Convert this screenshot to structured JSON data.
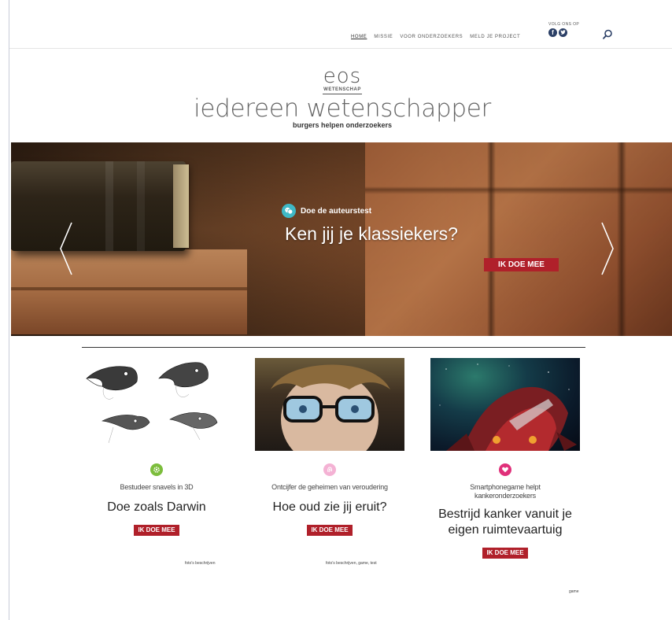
{
  "header": {
    "nav": [
      {
        "label": "HOME",
        "active": true
      },
      {
        "label": "MISSIE",
        "active": false
      },
      {
        "label": "VOOR ONDERZOEKERS",
        "active": false
      },
      {
        "label": "MELD JE PROJECT",
        "active": false
      }
    ],
    "social_label": "VOLG ONS OP",
    "social_icons": [
      "facebook-icon",
      "twitter-icon"
    ],
    "search_icon": "search-icon"
  },
  "logo": {
    "brand": "eos",
    "brand_sub": "WETENSCHAP",
    "main": "iedereen wetenschapper",
    "tagline": "burgers helpen onderzoekers"
  },
  "hero": {
    "kicker": "Doe de auteurstest",
    "title": "Ken jij je klassiekers?",
    "button": "IK DOE MEE",
    "kicker_icon_color": "#3fb9c6",
    "button_color": "#b0202a"
  },
  "cards": [
    {
      "icon": "gear-icon",
      "icon_color": "#7cbd3c",
      "description": "Bestudeer snavels in 3D",
      "title": "Doe zoals Darwin",
      "button": "IK DOE MEE",
      "credit": "foto's beschrijven"
    },
    {
      "icon": "fingerprint-icon",
      "icon_color": "#f08fc0",
      "description": "Ontcijfer de geheimen van veroudering",
      "title": "Hoe oud zie jij eruit?",
      "button": "IK DOE MEE",
      "credit": "foto's beschrijven, game, test"
    },
    {
      "icon": "heart-icon",
      "icon_color": "#e0307a",
      "description": "Smartphonegame helpt kankeronderzoekers",
      "title": "Bestrijd kanker vanuit je eigen ruimtevaartuig",
      "button": "IK DOE MEE",
      "credit": "game"
    }
  ]
}
